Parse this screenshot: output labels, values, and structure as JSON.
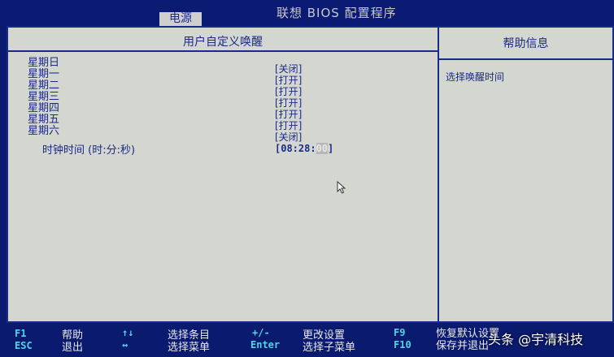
{
  "header": {
    "title": "联想 BIOS 配置程序",
    "active_tab": "电源"
  },
  "main": {
    "section_title": "用户自定义唤醒",
    "days": [
      {
        "label": "星期日",
        "value": "[关闭]"
      },
      {
        "label": "星期一",
        "value": "[打开]"
      },
      {
        "label": "星期二",
        "value": "[打开]"
      },
      {
        "label": "星期三",
        "value": "[打开]"
      },
      {
        "label": "星期四",
        "value": "[打开]"
      },
      {
        "label": "星期五",
        "value": "[打开]"
      },
      {
        "label": "星期六",
        "value": "[关闭]"
      }
    ],
    "clock": {
      "label": "时钟时间 (时:分:秒)",
      "value_prefix": "[08:28:",
      "value_seconds": "00",
      "value_suffix": "]"
    }
  },
  "help": {
    "title": "帮助信息",
    "text": "选择唤醒时间"
  },
  "footer": {
    "keys": [
      {
        "key": "F1",
        "desc": "帮助"
      },
      {
        "key": "ESC",
        "desc": "退出"
      },
      {
        "key": "↑↓",
        "desc": "选择条目"
      },
      {
        "key": "↔",
        "desc": "选择菜单"
      },
      {
        "key": "+/-",
        "desc": "更改设置"
      },
      {
        "key": "Enter",
        "desc": "选择子菜单"
      },
      {
        "key": "F9",
        "desc": "恢复默认设置"
      },
      {
        "key": "F10",
        "desc": "保存并退出"
      }
    ]
  },
  "watermark": "头条 @宇清科技",
  "colors": {
    "frame_blue": "#0a1a6e",
    "text_blue": "#1a2a8a",
    "panel_gray": "#d4d6d0",
    "key_cyan": "#4fd4e8"
  }
}
